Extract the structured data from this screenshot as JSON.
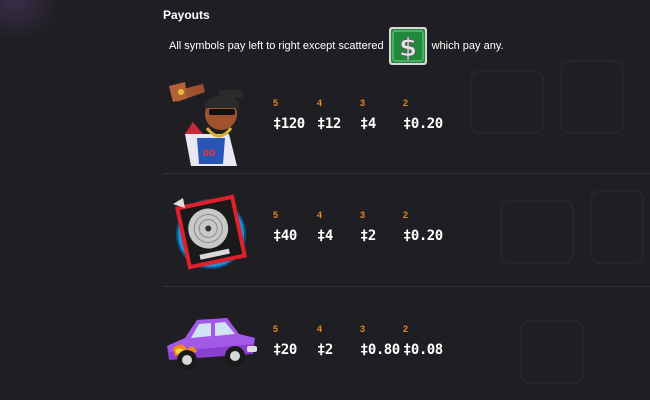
{
  "header": {
    "title": "Payouts",
    "intro_before": "All symbols pay left to right except scattered",
    "intro_after": "which pay any."
  },
  "scatter": {
    "icon": "dollar-sign-scatter-icon",
    "color": "#1e8a3a"
  },
  "paytable": [
    {
      "symbol": "rapper-character-icon",
      "payouts": [
        {
          "count": "5",
          "amount": "‡120"
        },
        {
          "count": "4",
          "amount": "‡12"
        },
        {
          "count": "3",
          "amount": "‡4"
        },
        {
          "count": "2",
          "amount": "‡0.20"
        }
      ]
    },
    {
      "symbol": "platinum-record-icon",
      "payouts": [
        {
          "count": "5",
          "amount": "‡40"
        },
        {
          "count": "4",
          "amount": "‡4"
        },
        {
          "count": "3",
          "amount": "‡2"
        },
        {
          "count": "2",
          "amount": "‡0.20"
        }
      ]
    },
    {
      "symbol": "purple-lowrider-car-icon",
      "payouts": [
        {
          "count": "5",
          "amount": "‡20"
        },
        {
          "count": "4",
          "amount": "‡2"
        },
        {
          "count": "3",
          "amount": "‡0.80"
        },
        {
          "count": "2",
          "amount": "‡0.08"
        }
      ]
    }
  ],
  "colors": {
    "background": "#1f1f23",
    "count_label": "#e58a1f",
    "amount_text": "#ffffff",
    "separator": "#303036"
  }
}
